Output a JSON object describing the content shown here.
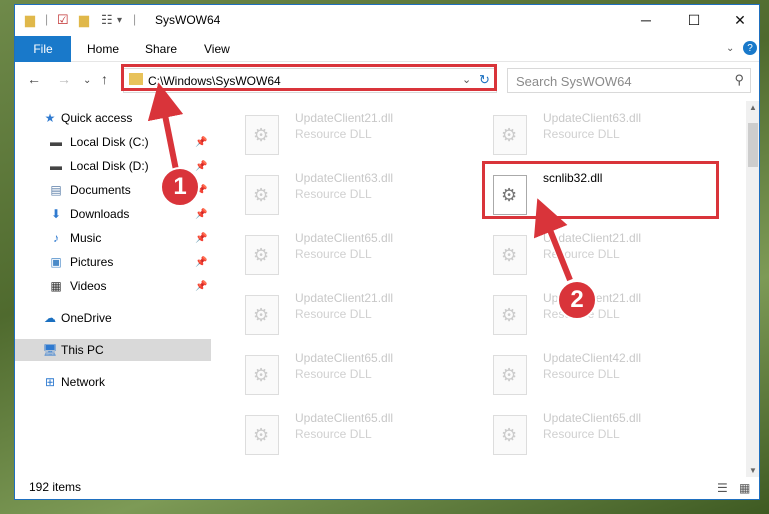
{
  "window": {
    "title": "SysWOW64",
    "minimize": "─",
    "maximize": "☐",
    "close": "✕"
  },
  "ribbon": {
    "file": "File",
    "home": "Home",
    "share": "Share",
    "view": "View"
  },
  "address": {
    "path": "C:\\Windows\\SysWOW64",
    "search_placeholder": "Search SysWOW64"
  },
  "sidebar": {
    "items": [
      {
        "label": "Quick access",
        "icon": "star-icon",
        "pinned": false
      },
      {
        "label": "Local Disk (C:)",
        "icon": "drive-icon",
        "pinned": true
      },
      {
        "label": "Local Disk (D:)",
        "icon": "drive-icon",
        "pinned": true
      },
      {
        "label": "Documents",
        "icon": "documents-icon",
        "pinned": true
      },
      {
        "label": "Downloads",
        "icon": "downloads-icon",
        "pinned": true
      },
      {
        "label": "Music",
        "icon": "music-icon",
        "pinned": true
      },
      {
        "label": "Pictures",
        "icon": "pictures-icon",
        "pinned": true
      },
      {
        "label": "Videos",
        "icon": "videos-icon",
        "pinned": true
      },
      {
        "label": "OneDrive",
        "icon": "cloud-icon",
        "pinned": false
      },
      {
        "label": "This PC",
        "icon": "computer-icon",
        "pinned": false,
        "selected": true
      },
      {
        "label": "Network",
        "icon": "network-icon",
        "pinned": false
      }
    ]
  },
  "files": [
    {
      "name": "UpdateClient21.dll",
      "type": "Resource DLL"
    },
    {
      "name": "UpdateClient63.dll",
      "type": "Resource DLL"
    },
    {
      "name": "UpdateClient63.dll",
      "type": "Resource DLL"
    },
    {
      "name": "scnlib32.dll",
      "type": ""
    },
    {
      "name": "UpdateClient65.dll",
      "type": "Resource DLL"
    },
    {
      "name": "UpdateClient21.dll",
      "type": "Resource DLL"
    },
    {
      "name": "UpdateClient21.dll",
      "type": "Resource DLL"
    },
    {
      "name": "UpdateClient21.dll",
      "type": "Resource DLL"
    },
    {
      "name": "UpdateClient65.dll",
      "type": "Resource DLL"
    },
    {
      "name": "UpdateClient42.dll",
      "type": "Resource DLL"
    },
    {
      "name": "UpdateClient65.dll",
      "type": "Resource DLL"
    },
    {
      "name": "UpdateClient65.dll",
      "type": "Resource DLL"
    }
  ],
  "status": {
    "items_count": "192 items"
  },
  "annotations": {
    "step1": "1",
    "step2": "2",
    "color": "#d9343a"
  }
}
